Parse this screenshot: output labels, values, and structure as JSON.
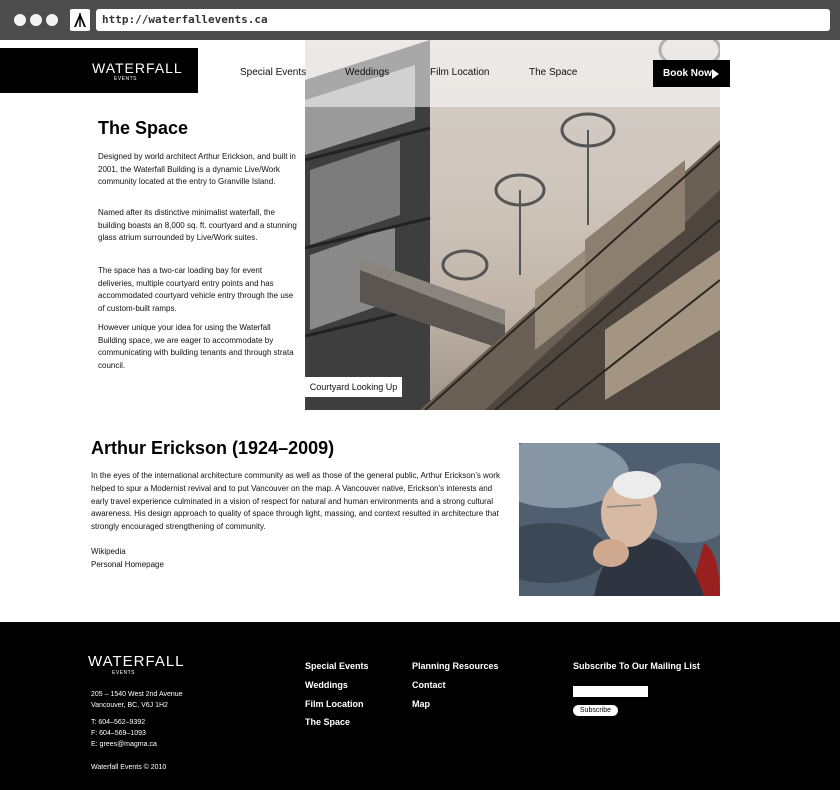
{
  "browser": {
    "url": "http://waterfallevents.ca"
  },
  "logo": {
    "wordmark": "WATERFALL",
    "sub": "EVENTS"
  },
  "nav": {
    "items": [
      "Special Events",
      "Weddings",
      "Film Location",
      "The Space"
    ],
    "book_now": "Book Now"
  },
  "hero": {
    "caption": "Courtyard Looking Up"
  },
  "space": {
    "title": "The Space",
    "paragraphs": [
      "Designed by world architect Arthur Erickson, and built in 2001, the Waterfall Building is a dynamic Live/Work community located at the entry to Granville Island.",
      "Named after its distinctive minimalist waterfall, the building boasts an 8,000 sq. ft. courtyard and a stunning glass atrium surrounded by Live/Work suites.",
      "The space has a two-car loading bay for event deliveries, multiple courtyard entry points and has accommodated courtyard vehicle entry through the use of custom-built ramps.",
      "However unique your idea for using the Waterfall Building space, we are eager to accommodate by communicating with building tenants and through strata council."
    ]
  },
  "arthur": {
    "title": "Arthur Erickson (1924–2009)",
    "body": "In the eyes of the international architecture community as well as those of the general public, Arthur Erickson’s work helped to spur a Modernist revival and to put Vancouver on the map. A Vancouver native, Erickson’s interests and early travel experience culminated in a vision of respect for natural and human environments and a strong cultural awareness.  His design approach to quality of space through light, massing, and context resulted in architecture that strongly encouraged strengthening of community.",
    "links": [
      "Wikipedia",
      "Personal Homepage"
    ]
  },
  "footer": {
    "address_line1": "205 – 1540 West 2nd Avenue",
    "address_line2": "Vancouver, BC, V6J 1H2",
    "phone": "T: 604–562–9392",
    "fax": "F: 604–569–1093",
    "email": "E: grees@magma.ca",
    "copyright": "Waterfall Events  ©  2010",
    "col1": [
      "Special Events",
      "Weddings",
      "Film Location",
      "The Space"
    ],
    "col2": [
      "Planning Resources",
      "Contact",
      "Map"
    ],
    "subscribe_title": "Subscribe To Our Mailing List",
    "subscribe_button": "Subscribe",
    "subscribe_value": ""
  }
}
